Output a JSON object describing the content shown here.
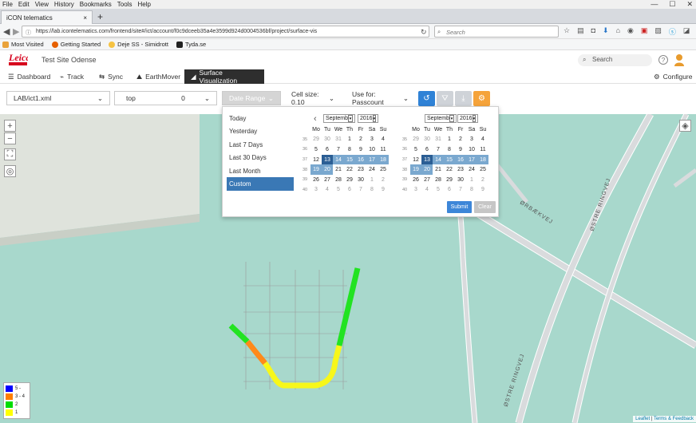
{
  "browser": {
    "menu": [
      "File",
      "Edit",
      "View",
      "History",
      "Bookmarks",
      "Tools",
      "Help"
    ],
    "tab_title": "iCON telematics",
    "tab_close": "×",
    "new_tab": "+",
    "url": "https://lab.icontelematics.com/frontend/site#/ict/account/f0c9dceeb35a4e3599d924d0004536bf/project/surface-vis",
    "search_placeholder": "Search",
    "bookmarks": [
      "Most Visited",
      "Getting Started",
      "Deje SS - Simidrott",
      "Tyda.se"
    ]
  },
  "app": {
    "site_name": "Test Site Odense",
    "search_placeholder": "Search",
    "help": "?",
    "nav": [
      "Dashboard",
      "Track",
      "Sync",
      "EarthMover",
      "Surface Visualization"
    ],
    "configure": "Configure"
  },
  "toolbar": {
    "design_file": "LAB/ict1.xml",
    "surface": "top",
    "offset": "0",
    "date_range": "Date Range",
    "cell_size": "Cell size: 0.10",
    "use_for": "Use for: Passcount"
  },
  "date_picker": {
    "presets": [
      "Today",
      "Yesterday",
      "Last 7 Days",
      "Last 30 Days",
      "Last Month",
      "Custom"
    ],
    "selected_preset": "Custom",
    "left_month": "Septemb",
    "left_year": "2016",
    "right_month": "Septemb",
    "right_year": "2016",
    "weekdays": [
      "Mo",
      "Tu",
      "We",
      "Th",
      "Fr",
      "Sa",
      "Su"
    ],
    "weeks": [
      {
        "wk": "35",
        "days": [
          "29",
          "30",
          "31",
          "1",
          "2",
          "3",
          "4"
        ]
      },
      {
        "wk": "36",
        "days": [
          "5",
          "6",
          "7",
          "8",
          "9",
          "10",
          "11"
        ]
      },
      {
        "wk": "37",
        "days": [
          "12",
          "13",
          "14",
          "15",
          "16",
          "17",
          "18"
        ]
      },
      {
        "wk": "38",
        "days": [
          "19",
          "20",
          "21",
          "22",
          "23",
          "24",
          "25"
        ]
      },
      {
        "wk": "39",
        "days": [
          "26",
          "27",
          "28",
          "29",
          "30",
          "1",
          "2"
        ]
      },
      {
        "wk": "40",
        "days": [
          "3",
          "4",
          "5",
          "6",
          "7",
          "8",
          "9"
        ]
      }
    ],
    "submit": "Submit",
    "clear": "Clear"
  },
  "map": {
    "legend": [
      {
        "label": "5 -",
        "color": "#0000ff"
      },
      {
        "label": "3 - 4",
        "color": "#ff7f00"
      },
      {
        "label": "2",
        "color": "#00dd00"
      },
      {
        "label": "1",
        "color": "#ffff00"
      }
    ],
    "street_1": "ØRBÆKVEJ",
    "street_2": "ØSTRE RINGVEJ",
    "attribution_1": "Leaflet",
    "attribution_sep": " | ",
    "attribution_2": "Terms & Feedback"
  }
}
